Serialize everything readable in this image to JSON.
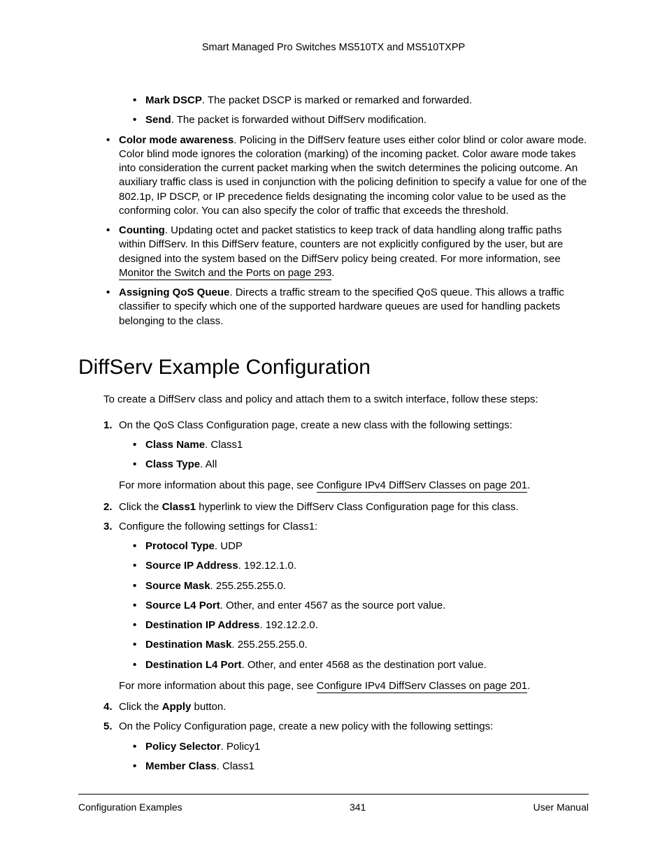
{
  "header": "Smart Managed Pro Switches MS510TX and MS510TXPP",
  "top_sub_bullets": [
    {
      "label": "Mark DSCP",
      "text": ". The packet DSCP is marked or remarked and forwarded."
    },
    {
      "label": "Send",
      "text": ". The packet is forwarded without DiffServ modification."
    }
  ],
  "top_bullets": {
    "color": {
      "label": "Color mode awareness",
      "text": ". Policing in the DiffServ feature uses either color blind or color aware mode. Color blind mode ignores the coloration (marking) of the incoming packet. Color aware mode takes into consideration the current packet marking when the switch determines the policing outcome. An auxiliary traffic class is used in conjunction with the policing definition to specify a value for one of the 802.1p, IP DSCP, or IP precedence fields designating the incoming color value to be used as the conforming color. You can also specify the color of traffic that exceeds the threshold."
    },
    "counting": {
      "label": "Counting",
      "text_before": ". Updating octet and packet statistics to keep track of data handling along traffic paths within DiffServ. In this DiffServ feature, counters are not explicitly configured by the user, but are designed into the system based on the DiffServ policy being created. For more information, see ",
      "xref": "Monitor the Switch and the Ports on page 293",
      "text_after": "."
    },
    "qos": {
      "label": "Assigning QoS Queue",
      "text": ". Directs a traffic stream to the specified QoS queue. This allows a traffic classifier to specify which one of the supported hardware queues are used for handling packets belonging to the class."
    }
  },
  "section_heading": "DiffServ Example Configuration",
  "intro": "To create a DiffServ class and policy and attach them to a switch interface, follow these steps:",
  "steps": {
    "s1": {
      "num": "1.",
      "text": "On the QoS Class Configuration page, create a new class with the following settings:",
      "bullets": [
        {
          "label": "Class Name",
          "text": ". Class1"
        },
        {
          "label": "Class Type",
          "text": ". All"
        }
      ],
      "after_before": "For more information about this page, see ",
      "after_xref": "Configure IPv4 DiffServ Classes on page 201",
      "after_after": "."
    },
    "s2": {
      "num": "2.",
      "before": "Click the ",
      "bold": "Class1",
      "after": " hyperlink to view the DiffServ Class Configuration page for this class."
    },
    "s3": {
      "num": "3.",
      "text": "Configure the following settings for Class1:",
      "bullets": [
        {
          "label": "Protocol Type",
          "text": ". UDP"
        },
        {
          "label": "Source IP Address",
          "text": ". 192.12.1.0."
        },
        {
          "label": "Source Mask",
          "text": ". 255.255.255.0."
        },
        {
          "label": "Source L4 Port",
          "text": ". Other, and enter 4567 as the source port value."
        },
        {
          "label": "Destination IP Address",
          "text": ". 192.12.2.0."
        },
        {
          "label": "Destination Mask",
          "text": ". 255.255.255.0."
        },
        {
          "label": "Destination L4 Port",
          "text": ". Other, and enter 4568 as the destination port value."
        }
      ],
      "after_before": "For more information about this page, see ",
      "after_xref": "Configure IPv4 DiffServ Classes on page 201",
      "after_after": "."
    },
    "s4": {
      "num": "4.",
      "before": "Click the ",
      "bold": "Apply",
      "after": " button."
    },
    "s5": {
      "num": "5.",
      "text": "On the Policy Configuration page, create a new policy with the following settings:",
      "bullets": [
        {
          "label": "Policy Selector",
          "text": ". Policy1"
        },
        {
          "label": "Member Class",
          "text": ". Class1"
        }
      ]
    }
  },
  "footer": {
    "left": "Configuration Examples",
    "center": "341",
    "right": "User Manual"
  }
}
